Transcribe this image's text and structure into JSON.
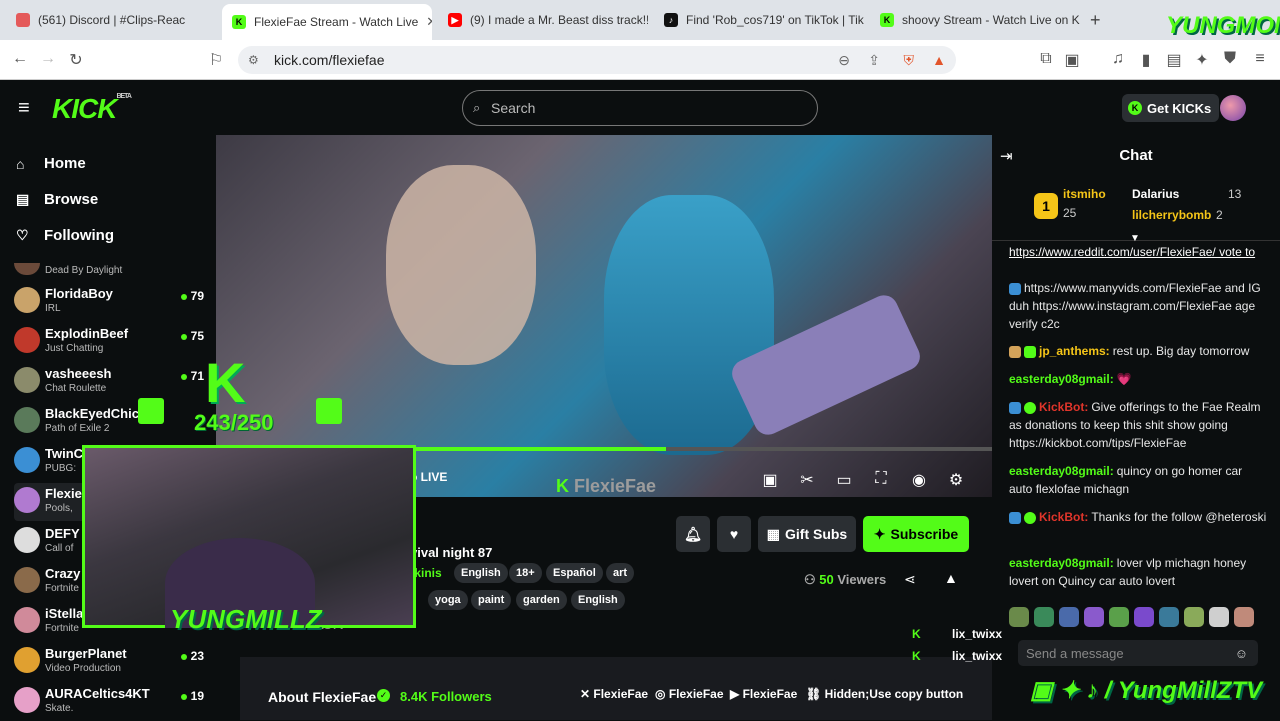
{
  "browser": {
    "tabs": [
      {
        "title": "(561) Discord | #Clips-Reac",
        "favicon_color": "#e45a5a",
        "active": false
      },
      {
        "title": "FlexieFae Stream - Watch Live",
        "favicon_color": "#53fc18",
        "active": true
      },
      {
        "title": "(9) I made a Mr. Beast diss track!!",
        "favicon_color": "#ff0000",
        "active": false
      },
      {
        "title": "Find 'Rob_cos719' on TikTok | TikT",
        "favicon_color": "#111111",
        "active": false
      },
      {
        "title": "shoovy Stream - Watch Live on Ki",
        "favicon_color": "#53fc18",
        "active": false
      }
    ],
    "url": "kick.com/flexiefae"
  },
  "header": {
    "logo": "KICK",
    "logo_badge": "BETA",
    "search_placeholder": "Search",
    "get_kicks": "Get KICKs"
  },
  "sidebar": {
    "nav": [
      {
        "label": "Home",
        "icon": "home-icon"
      },
      {
        "label": "Browse",
        "icon": "browse-icon"
      },
      {
        "label": "Following",
        "icon": "heart-icon"
      }
    ],
    "partial_category": "Dead By Daylight",
    "channels": [
      {
        "name": "FloridaBoy",
        "category": "IRL",
        "viewers": "79",
        "color": "#c9a36a"
      },
      {
        "name": "ExplodinBeef",
        "category": "Just Chatting",
        "viewers": "75",
        "color": "#c0392b"
      },
      {
        "name": "vasheeesh",
        "category": "Chat Roulette",
        "viewers": "71",
        "color": "#8b8b6b"
      },
      {
        "name": "BlackEyedChick",
        "category": "Path of Exile 2",
        "viewers": "",
        "color": "#5a7a5a"
      },
      {
        "name": "TwinC",
        "category": "PUBG:",
        "viewers": "",
        "color": "#3b8fd4"
      },
      {
        "name": "Flexie",
        "category": "Pools,",
        "viewers": "",
        "color": "#b07ad0"
      },
      {
        "name": "DEFY",
        "category": "Call of",
        "viewers": "",
        "color": "#dddddd"
      },
      {
        "name": "Crazy",
        "category": "Fortnite",
        "viewers": "",
        "color": "#8a6a4a"
      },
      {
        "name": "iStella",
        "category": "Fortnite",
        "viewers": "",
        "color": "#d08a9a"
      },
      {
        "name": "BurgerPlanet",
        "category": "Video Production",
        "viewers": "23",
        "color": "#e0a030"
      },
      {
        "name": "AURACeltics4KT",
        "category": "Skate.",
        "viewers": "19",
        "color": "#e6a0c8"
      }
    ]
  },
  "player": {
    "live_label": "o LIVE",
    "watermark": "FlexieFae",
    "progress_fraction": 0.58
  },
  "stream_info": {
    "title_partial": "vival night 87",
    "category_partial": "ikinis",
    "tags_row1": [
      "English",
      "18+",
      "Español",
      "art"
    ],
    "tags_row2": [
      "yoga",
      "paint",
      "garden",
      "English"
    ],
    "gift_subs": "Gift Subs",
    "subscribe": "Subscribe",
    "viewers_count": "50",
    "viewers_label": "Viewers",
    "partial_text": "RSTV"
  },
  "about": {
    "title": "About FlexieFae",
    "followers": "8.4K Followers",
    "socials": [
      {
        "icon": "x-icon",
        "label": "FlexieFae"
      },
      {
        "icon": "instagram-icon",
        "label": "FlexieFae"
      },
      {
        "icon": "youtube-icon",
        "label": "FlexieFae"
      },
      {
        "icon": "link-icon",
        "label": "Hidden;Use copy button"
      }
    ]
  },
  "chat": {
    "title": "Chat",
    "leaderboard": [
      {
        "name": "itsmiho",
        "value": "25",
        "rank": "1"
      },
      {
        "name": "Dalarius",
        "value": "13"
      },
      {
        "name": "lilcherrybomb",
        "value": "2"
      }
    ],
    "messages": [
      {
        "user": "",
        "color": "#ffffff",
        "text": "https://www.reddit.com/user/FlexieFae/ vote to help FlexieFae win the Contest on @ManyVids"
      },
      {
        "user": "",
        "color": "#ffffff",
        "text": "https://www.manyvids.com/FlexieFae and IG duh https://www.instagram.com/FlexieFae age verify c2c"
      },
      {
        "user": "jp_anthems:",
        "color": "#f5c518",
        "text": "rest up. Big day tomorrow"
      },
      {
        "user": "easterday08gmail:",
        "color": "#53fc18",
        "text": "💗"
      },
      {
        "user": "KickBot:",
        "color": "#e0352b",
        "text": "Give offerings to the Fae Realm as donations to keep this shit show going https://kickbot.com/tips/FlexieFae"
      },
      {
        "user": "easterday08gmail:",
        "color": "#53fc18",
        "text": "quincy on go homer car auto flexlofae michagn"
      },
      {
        "user": "KickBot:",
        "color": "#e0352b",
        "text": "Thanks for the follow @heteroski"
      },
      {
        "user": "easterday08gmail:",
        "color": "#53fc18",
        "text": "lover vlp michagn honey lovert on Quincy car auto lovert"
      }
    ],
    "send_placeholder": "Send a message",
    "overlay_users": [
      "lix_twixx",
      "lix_twixx"
    ]
  },
  "overlay": {
    "sub_goal": "243/250",
    "goal_letter": "K",
    "pip_name": "YUNGMILLZ",
    "top_brand": "YUNGMONEY",
    "bottom_brand": "/ YungMillZTV"
  },
  "colors": {
    "accent": "#53fc18",
    "background": "#0b0e0f"
  }
}
